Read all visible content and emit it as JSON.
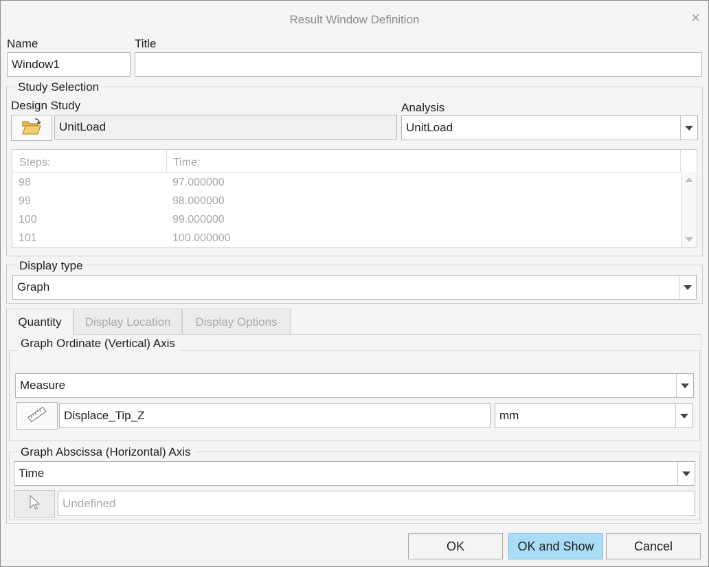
{
  "dialog": {
    "title": "Result Window Definition",
    "close_glyph": "×"
  },
  "name": {
    "label": "Name",
    "value": "Window1"
  },
  "title_field": {
    "label": "Title",
    "value": ""
  },
  "study_selection": {
    "legend": "Study Selection",
    "design_study_label": "Design Study",
    "design_study_value": "UnitLoad",
    "analysis_label": "Analysis",
    "analysis_value": "UnitLoad",
    "icon": "folder-open-icon"
  },
  "steps_table": {
    "headers": [
      "Steps:",
      "Time:"
    ],
    "rows": [
      [
        "98",
        "97.000000"
      ],
      [
        "99",
        "98.000000"
      ],
      [
        "100",
        "99.000000"
      ],
      [
        "101",
        "100.000000"
      ]
    ]
  },
  "display_type": {
    "legend": "Display type",
    "value": "Graph"
  },
  "tabs": [
    {
      "label": "Quantity",
      "active": true
    },
    {
      "label": "Display Location",
      "active": false
    },
    {
      "label": "Display Options",
      "active": false
    }
  ],
  "ordinate": {
    "legend": "Graph Ordinate (Vertical) Axis",
    "quantity": "Measure",
    "measure_value": "Displace_Tip_Z",
    "unit": "mm",
    "icon": "ruler-icon"
  },
  "abscissa": {
    "legend": "Graph Abscissa (Horizontal) Axis",
    "quantity": "Time",
    "placeholder": "Undefined",
    "icon": "cursor-pointer-icon"
  },
  "buttons": {
    "ok": "OK",
    "ok_show": "OK and Show",
    "cancel": "Cancel"
  },
  "colors": {
    "primary_button": "#a9dcf5",
    "dialog_bg": "#f4f4f4",
    "disabled_text": "#a8a8a8"
  }
}
